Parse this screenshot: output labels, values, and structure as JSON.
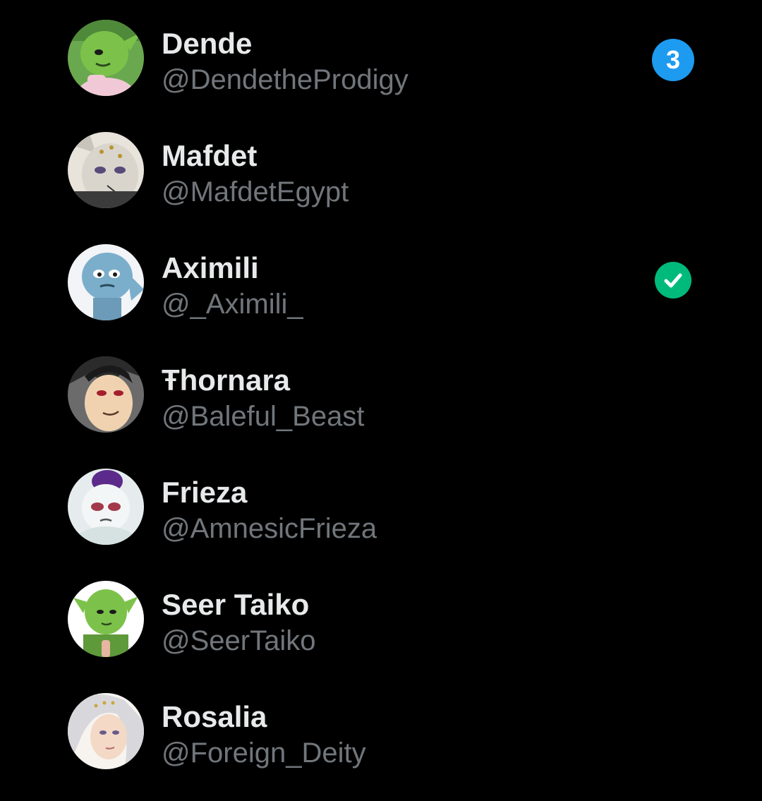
{
  "accounts": [
    {
      "name": "Dende",
      "handle": "@DendetheProdigy",
      "avatar_icon": "green-character-avatar",
      "badge": "3"
    },
    {
      "name": "Mafdet",
      "handle": "@MafdetEgypt",
      "avatar_icon": "cat-character-avatar"
    },
    {
      "name": "Aximili",
      "handle": "@_Aximili_",
      "avatar_icon": "blue-character-avatar",
      "status_icon": "selected-check-icon"
    },
    {
      "name": "Ŧhornara",
      "handle": "@Baleful_Beast",
      "avatar_icon": "dark-haired-character-avatar"
    },
    {
      "name": "Frieza",
      "handle": "@AmnesicFrieza",
      "avatar_icon": "white-purple-character-avatar"
    },
    {
      "name": "Seer Taiko",
      "handle": "@SeerTaiko",
      "avatar_icon": "green-character-avatar"
    },
    {
      "name": "Rosalia",
      "handle": "@Foreign_Deity",
      "avatar_icon": "white-haired-character-avatar"
    }
  ],
  "colors": {
    "background": "#000000",
    "name_text": "#e7e9ea",
    "handle_text": "#71767b",
    "badge_blue": "#1d9bf0",
    "check_green": "#00ba7c"
  }
}
